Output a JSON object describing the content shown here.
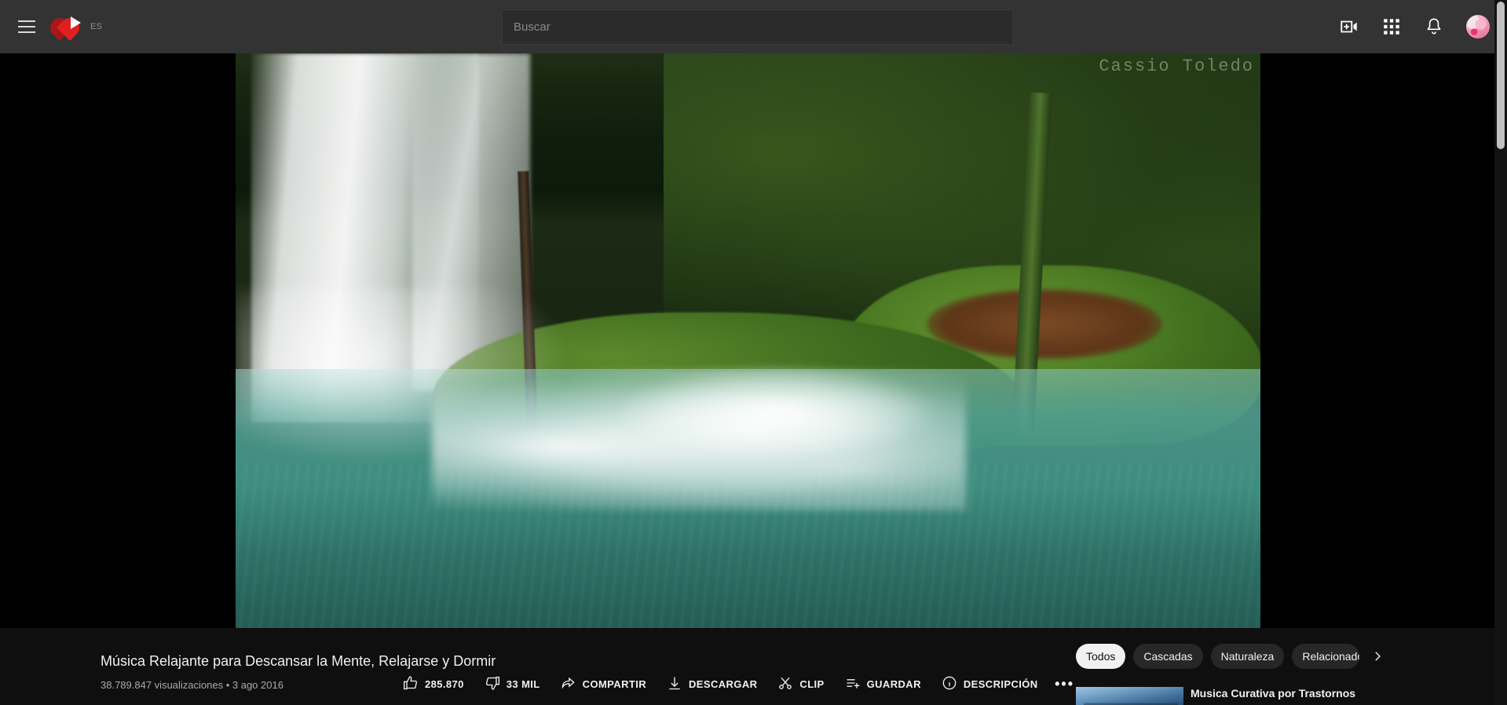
{
  "header": {
    "menu_icon": "hamburger-icon",
    "logo": "youtube-heart-logo",
    "country_code": "ES",
    "search": {
      "placeholder": "Buscar",
      "value": ""
    },
    "icons": [
      {
        "name": "create-video-icon",
        "label": "Crear"
      },
      {
        "name": "apps-grid-icon",
        "label": "Aplicaciones de Google"
      },
      {
        "name": "notifications-bell-icon",
        "label": "Notificaciones"
      },
      {
        "name": "avatar",
        "label": "Cuenta"
      }
    ],
    "background": "#333333"
  },
  "player": {
    "watermark": "Cassio Toledo",
    "background": "#000000"
  },
  "video": {
    "title": "Música Relajante para Descansar la Mente, Relajarse y Dormir",
    "views": "38.789.847 visualizaciones",
    "separator": "•",
    "date": "3 ago 2016",
    "meta": "38.789.847 visualizaciones • 3 ago 2016"
  },
  "actions": [
    {
      "name": "like-button",
      "icon": "thumbs-up-icon",
      "label": "285.870"
    },
    {
      "name": "dislike-button",
      "icon": "thumbs-down-icon",
      "label": "33 MIL"
    },
    {
      "name": "share-button",
      "icon": "share-arrow-icon",
      "label": "COMPARTIR"
    },
    {
      "name": "download-button",
      "icon": "download-icon",
      "label": "DESCARGAR"
    },
    {
      "name": "clip-button",
      "icon": "scissors-icon",
      "label": "CLIP"
    },
    {
      "name": "save-button",
      "icon": "save-playlist-icon",
      "label": "GUARDAR"
    },
    {
      "name": "description-button",
      "icon": "info-circle-icon",
      "label": "DESCRIPCIÓN"
    }
  ],
  "more_actions_label": "•••",
  "chips": [
    {
      "label": "Todos",
      "active": true
    },
    {
      "label": "Cascadas",
      "active": false
    },
    {
      "label": "Naturaleza",
      "active": false
    },
    {
      "label": "Relacionados",
      "active": false
    }
  ],
  "chips_next_icon": "chevron-right-icon",
  "related": [
    {
      "title": "Musica Curativa por Trastornos"
    }
  ],
  "colors": {
    "brand_red": "#c62020",
    "header_bg": "#333333",
    "page_bg": "#0f0f0f",
    "chip_bg": "#272727",
    "chip_active_bg": "#f1f1f1",
    "text_primary": "#f1f1f1",
    "text_secondary": "#aaaaaa",
    "scrollbar_thumb": "#c1c1c1"
  },
  "scrollbar": {
    "position": "top"
  }
}
